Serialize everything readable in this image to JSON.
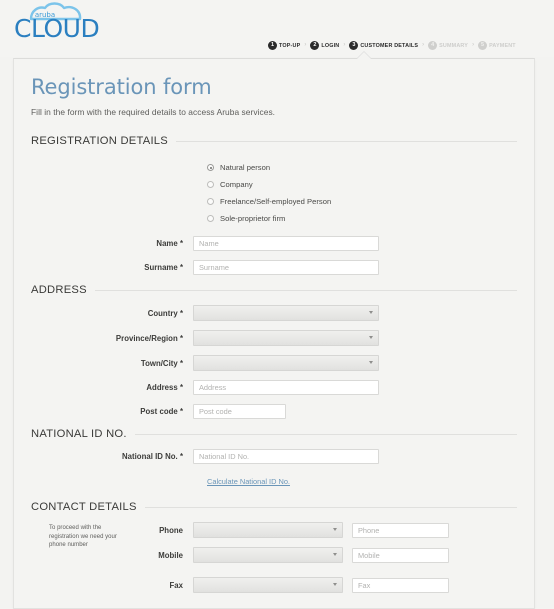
{
  "brand": {
    "name": "aruba",
    "product": "CLOUD",
    "accent_color": "#3c9bd7",
    "text_color": "#2b7fc0"
  },
  "steps": {
    "separator": "›",
    "items": [
      {
        "num": "1",
        "label": "TOP-UP",
        "state": "done"
      },
      {
        "num": "2",
        "label": "LOGIN",
        "state": "done"
      },
      {
        "num": "3",
        "label": "CUSTOMER DETAILS",
        "state": "current"
      },
      {
        "num": "4",
        "label": "SUMMARY",
        "state": "upcoming"
      },
      {
        "num": "5",
        "label": "PAYMENT",
        "state": "upcoming"
      }
    ]
  },
  "page": {
    "title": "Registration form",
    "subtitle": "Fill in the form with the required details to access Aruba services.",
    "title_color": "#6a95b8"
  },
  "registration_details": {
    "section_title": "REGISTRATION DETAILS",
    "options": [
      {
        "label": "Natural person",
        "selected": true
      },
      {
        "label": "Company",
        "selected": false
      },
      {
        "label": "Freelance/Self-employed Person",
        "selected": false
      },
      {
        "label": "Sole-proprietor firm",
        "selected": false
      }
    ],
    "fields": [
      {
        "label": "Name",
        "required": "*",
        "placeholder": "Name",
        "value": "",
        "type": "text"
      },
      {
        "label": "Surname",
        "required": "*",
        "placeholder": "Surname",
        "value": "",
        "type": "text"
      }
    ]
  },
  "address": {
    "section_title": "ADDRESS",
    "fields": [
      {
        "label": "Country",
        "required": "*",
        "type": "select",
        "value": ""
      },
      {
        "label": "Province/Region",
        "required": "*",
        "type": "select",
        "value": ""
      },
      {
        "label": "Town/City",
        "required": "*",
        "type": "select",
        "value": ""
      },
      {
        "label": "Address",
        "required": "*",
        "type": "text",
        "placeholder": "Address",
        "value": ""
      },
      {
        "label": "Post code",
        "required": "*",
        "type": "text",
        "placeholder": "Post code",
        "value": ""
      }
    ]
  },
  "national_id": {
    "section_title": "NATIONAL ID NO.",
    "field": {
      "label": "National ID No.",
      "required": "*",
      "placeholder": "National ID No.",
      "value": ""
    },
    "link": "Calculate National ID No."
  },
  "contact_details": {
    "section_title": "CONTACT DETAILS",
    "hint": "To proceed with the registration we need your phone number",
    "rows": [
      {
        "label": "Phone",
        "prefix_value": "",
        "placeholder": "Phone",
        "value": ""
      },
      {
        "label": "Mobile",
        "prefix_value": "",
        "placeholder": "Mobile",
        "value": ""
      },
      {
        "label": "Fax",
        "prefix_value": "",
        "placeholder": "Fax",
        "value": ""
      }
    ]
  }
}
